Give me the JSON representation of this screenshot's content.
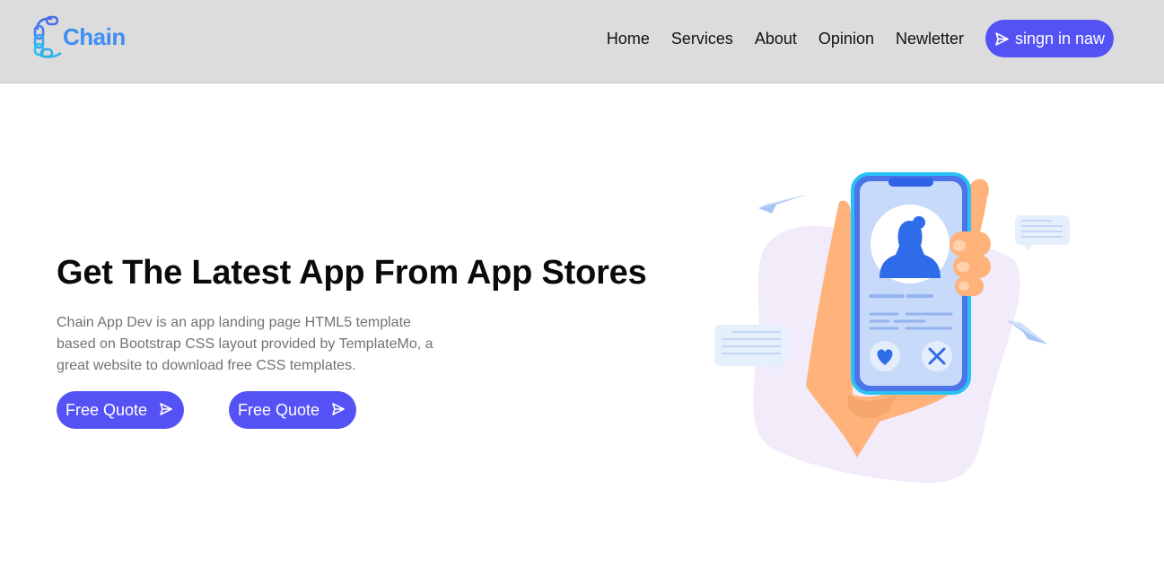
{
  "brand": {
    "name": "Chain",
    "logo_icon": "chain-link-icon",
    "color": "#3f8ef5"
  },
  "nav": {
    "items": [
      {
        "label": "Home"
      },
      {
        "label": "Services"
      },
      {
        "label": "About"
      },
      {
        "label": "Opinion"
      },
      {
        "label": "Newletter"
      }
    ],
    "signin_label": "singn in naw",
    "signin_icon": "paper-plane-icon"
  },
  "hero": {
    "title": "Get The Latest App From App Stores",
    "description": "Chain App Dev is an app landing page HTML5 template based on Bootstrap CSS layout provided by TemplateMo, a great website to download free CSS templates.",
    "buttons": [
      {
        "label": "Free Quote",
        "icon": "paper-plane-icon"
      },
      {
        "label": "Free Quote",
        "icon": "paper-plane-icon"
      }
    ]
  },
  "colors": {
    "accent": "#5452f5",
    "navbar_bg": "#dcdcdc"
  }
}
